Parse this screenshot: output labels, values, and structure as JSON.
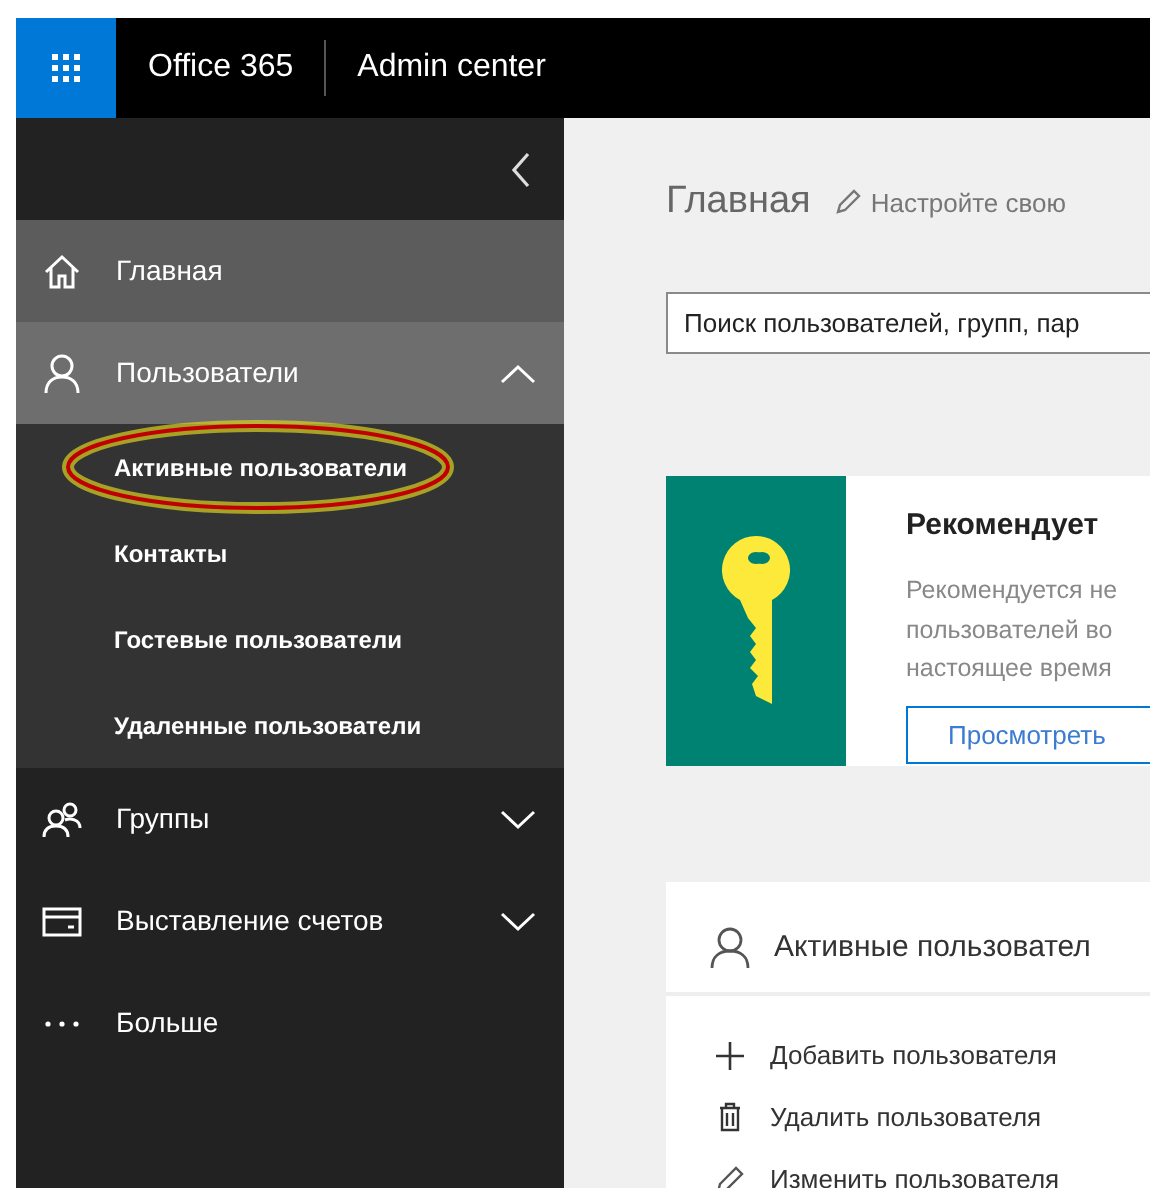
{
  "top_bar": {
    "product": "Office 365",
    "app": "Admin center"
  },
  "sidebar": {
    "items": [
      {
        "label": "Главная",
        "selected": true
      },
      {
        "label": "Пользователи",
        "selected": false,
        "expanded": true,
        "children": [
          {
            "label": "Активные пользователи",
            "highlighted": true
          },
          {
            "label": "Контакты",
            "highlighted": false
          },
          {
            "label": "Гостевые пользователи",
            "highlighted": false
          },
          {
            "label": "Удаленные пользователи",
            "highlighted": false
          }
        ]
      },
      {
        "label": "Группы",
        "selected": false,
        "expanded": false
      },
      {
        "label": "Выставление счетов",
        "selected": false,
        "expanded": false
      },
      {
        "label": "Больше",
        "selected": false
      }
    ]
  },
  "main": {
    "title": "Главная",
    "customize_link": "Настройте свою",
    "search": {
      "placeholder": "Поиск пользователей, групп, пар"
    },
    "recommendation": {
      "title": "Рекомендует",
      "lines": [
        "Рекомендуется не",
        "пользователей во",
        "настоящее время"
      ],
      "button": "Просмотреть"
    },
    "users_card": {
      "title": "Активные пользовател",
      "actions": [
        "Добавить пользователя",
        "Удалить пользователя",
        "Изменить пользователя"
      ]
    }
  }
}
